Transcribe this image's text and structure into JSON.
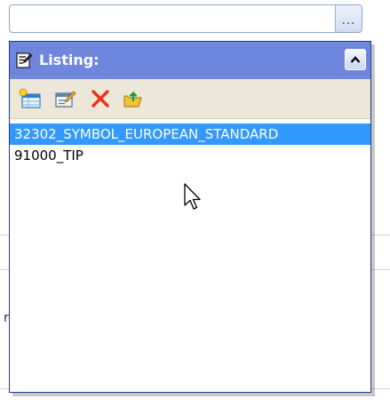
{
  "field": {
    "value": "",
    "browse_label": "..."
  },
  "page_behind": {
    "partial_glyph": "r"
  },
  "popup": {
    "title": "Listing:",
    "header_icon": "edit-list-icon",
    "collapse_icon": "chevron-up-icon",
    "toolbar": [
      {
        "name": "new-item-button",
        "icon": "new-item-icon"
      },
      {
        "name": "edit-item-button",
        "icon": "edit-item-icon"
      },
      {
        "name": "delete-item-button",
        "icon": "delete-icon"
      },
      {
        "name": "open-folder-button",
        "icon": "folder-up-icon"
      }
    ],
    "items": [
      {
        "label": "32302_SYMBOL_EUROPEAN_STANDARD",
        "selected": true
      },
      {
        "label": "91000_TIP",
        "selected": false
      }
    ]
  },
  "colors": {
    "header_bg": "#6f86dd",
    "selection_bg": "#3399ff",
    "toolbar_bg": "#ede7d9",
    "popup_border": "#1f3a8c"
  }
}
